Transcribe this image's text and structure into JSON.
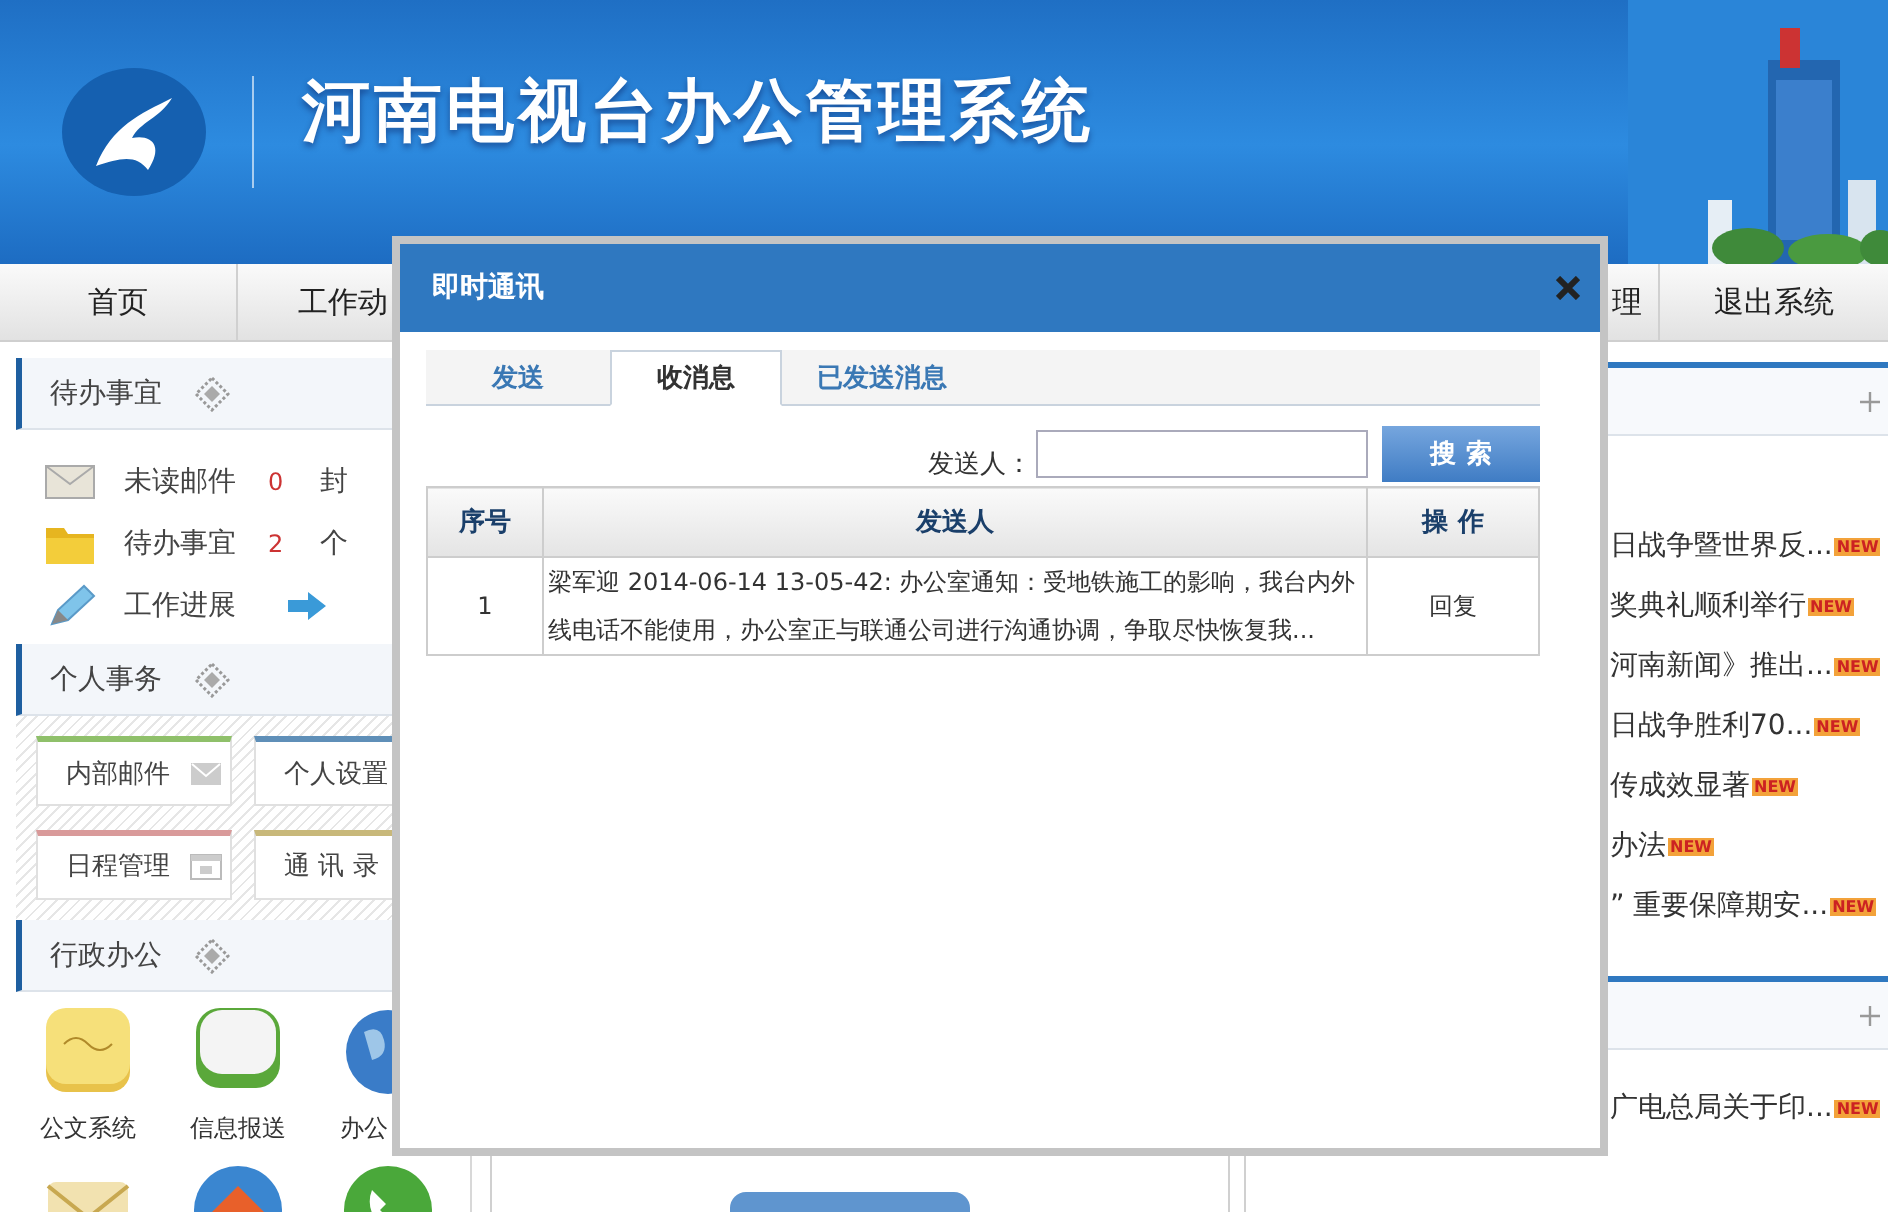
{
  "header": {
    "title": "河南电视台办公管理系统"
  },
  "nav": [
    {
      "label": "首页"
    },
    {
      "label": "工作动"
    },
    {
      "label": "理"
    },
    {
      "label": "退出系统"
    }
  ],
  "todo": {
    "title": "待办事宜",
    "items": [
      {
        "kind": "mail",
        "label": "未读邮件",
        "count": "0",
        "unit": "封"
      },
      {
        "kind": "folder",
        "label": "待办事宜",
        "count": "2",
        "unit": "个"
      },
      {
        "kind": "progress",
        "label": "工作进展"
      }
    ]
  },
  "personal": {
    "title": "个人事务",
    "tiles": [
      {
        "label": "内部邮件",
        "kind": "mail",
        "color": "#8fc06a"
      },
      {
        "label": "个人设置",
        "kind": "plain",
        "color": "#5f8fb8"
      },
      {
        "label": "日程管理",
        "kind": "calendar",
        "color": "#d99a9a"
      },
      {
        "label": "通 讯 录",
        "kind": "plain",
        "color": "#c8b87a"
      }
    ]
  },
  "office": {
    "title": "行政办公",
    "apps": [
      {
        "label": "公文系统",
        "kind": "note"
      },
      {
        "label": "信息报送",
        "kind": "chat"
      },
      {
        "label": "办公",
        "kind": "globe"
      },
      {
        "kind": "envelope"
      },
      {
        "kind": "house"
      },
      {
        "kind": "phone"
      }
    ]
  },
  "right_panels": [
    {
      "items": [
        {
          "text": "日战争暨世界反...",
          "badge": "NEW"
        },
        {
          "text": "奖典礼顺利举行",
          "badge": "NEW"
        },
        {
          "text": "河南新闻》推出...",
          "badge": "NEW"
        },
        {
          "text": "日战争胜利70...",
          "badge": "NEW"
        },
        {
          "text": "传成效显著",
          "badge": "NEW"
        },
        {
          "text": "办法",
          "badge": "NEW"
        },
        {
          "text": "” 重要保障期安...",
          "badge": "NEW"
        }
      ]
    },
    {
      "items": [
        {
          "text": "广电总局关于印...",
          "badge": "NEW"
        }
      ]
    }
  ],
  "dialog": {
    "title": "即时通讯",
    "tabs": [
      {
        "label": "发送",
        "selected": false
      },
      {
        "label": "收消息",
        "selected": true
      },
      {
        "label": "已发送消息",
        "selected": false
      }
    ],
    "search": {
      "label": "发送人：",
      "button": "搜 索"
    },
    "table": {
      "columns": [
        "序号",
        "发送人",
        "操 作"
      ],
      "rows": [
        {
          "cells": [
            "1",
            "梁军迎 2014-06-14 13-05-42: 办公室通知：受地铁施工的影响，我台内外线电话不能使用，办公室正与联通公司进行沟通协调，争取尽快恢复我...",
            "回复"
          ]
        }
      ]
    }
  }
}
